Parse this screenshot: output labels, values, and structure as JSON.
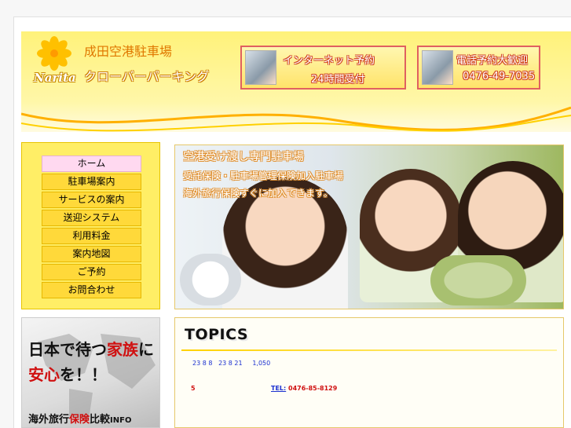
{
  "header": {
    "logo_text": "Narita",
    "site_title": "成田空港駐車場",
    "site_subtitle": "クローバーパーキング",
    "net_reservation": {
      "line1": "インターネット予約",
      "line2": "24時間受付"
    },
    "phone_reservation": {
      "line1": "電話予約大歓迎",
      "line2": "0476-49-7035"
    }
  },
  "menu": {
    "items": [
      {
        "label": "ホーム"
      },
      {
        "label": "駐車場案内"
      },
      {
        "label": "サービスの案内"
      },
      {
        "label": "送迎システム"
      },
      {
        "label": "利用料金"
      },
      {
        "label": "案内地図"
      },
      {
        "label": "ご予約"
      },
      {
        "label": "お問合わせ"
      }
    ]
  },
  "banner": {
    "line1": "空港受け渡し専門駐車場",
    "line2": "受託保険・駐車場管理保険加入駐車場",
    "line3": "海外旅行保険すぐに加入できます。"
  },
  "ad": {
    "line1_a": "日本で待つ",
    "line1_b": "家族",
    "line1_c": "に",
    "line2_a": "安心",
    "line2_b": "を！！",
    "line3_a": "海外旅行",
    "line3_b": "保険",
    "line3_c": "比較",
    "line3_d": "INFO"
  },
  "topics": {
    "title": "TOPICS",
    "news1": "23 8 8   23 8 21     1,050",
    "news2": "5",
    "news3_label": "TEL:",
    "news3_value": " 0476-85-8129"
  },
  "colors": {
    "header_yellow": "#fff27a",
    "menu_bg": "#ffee66",
    "menu_item": "#ffd93a",
    "menu_active": "#ffd9f0",
    "news_blue": "#1a2fd0",
    "news_red": "#d01010"
  }
}
